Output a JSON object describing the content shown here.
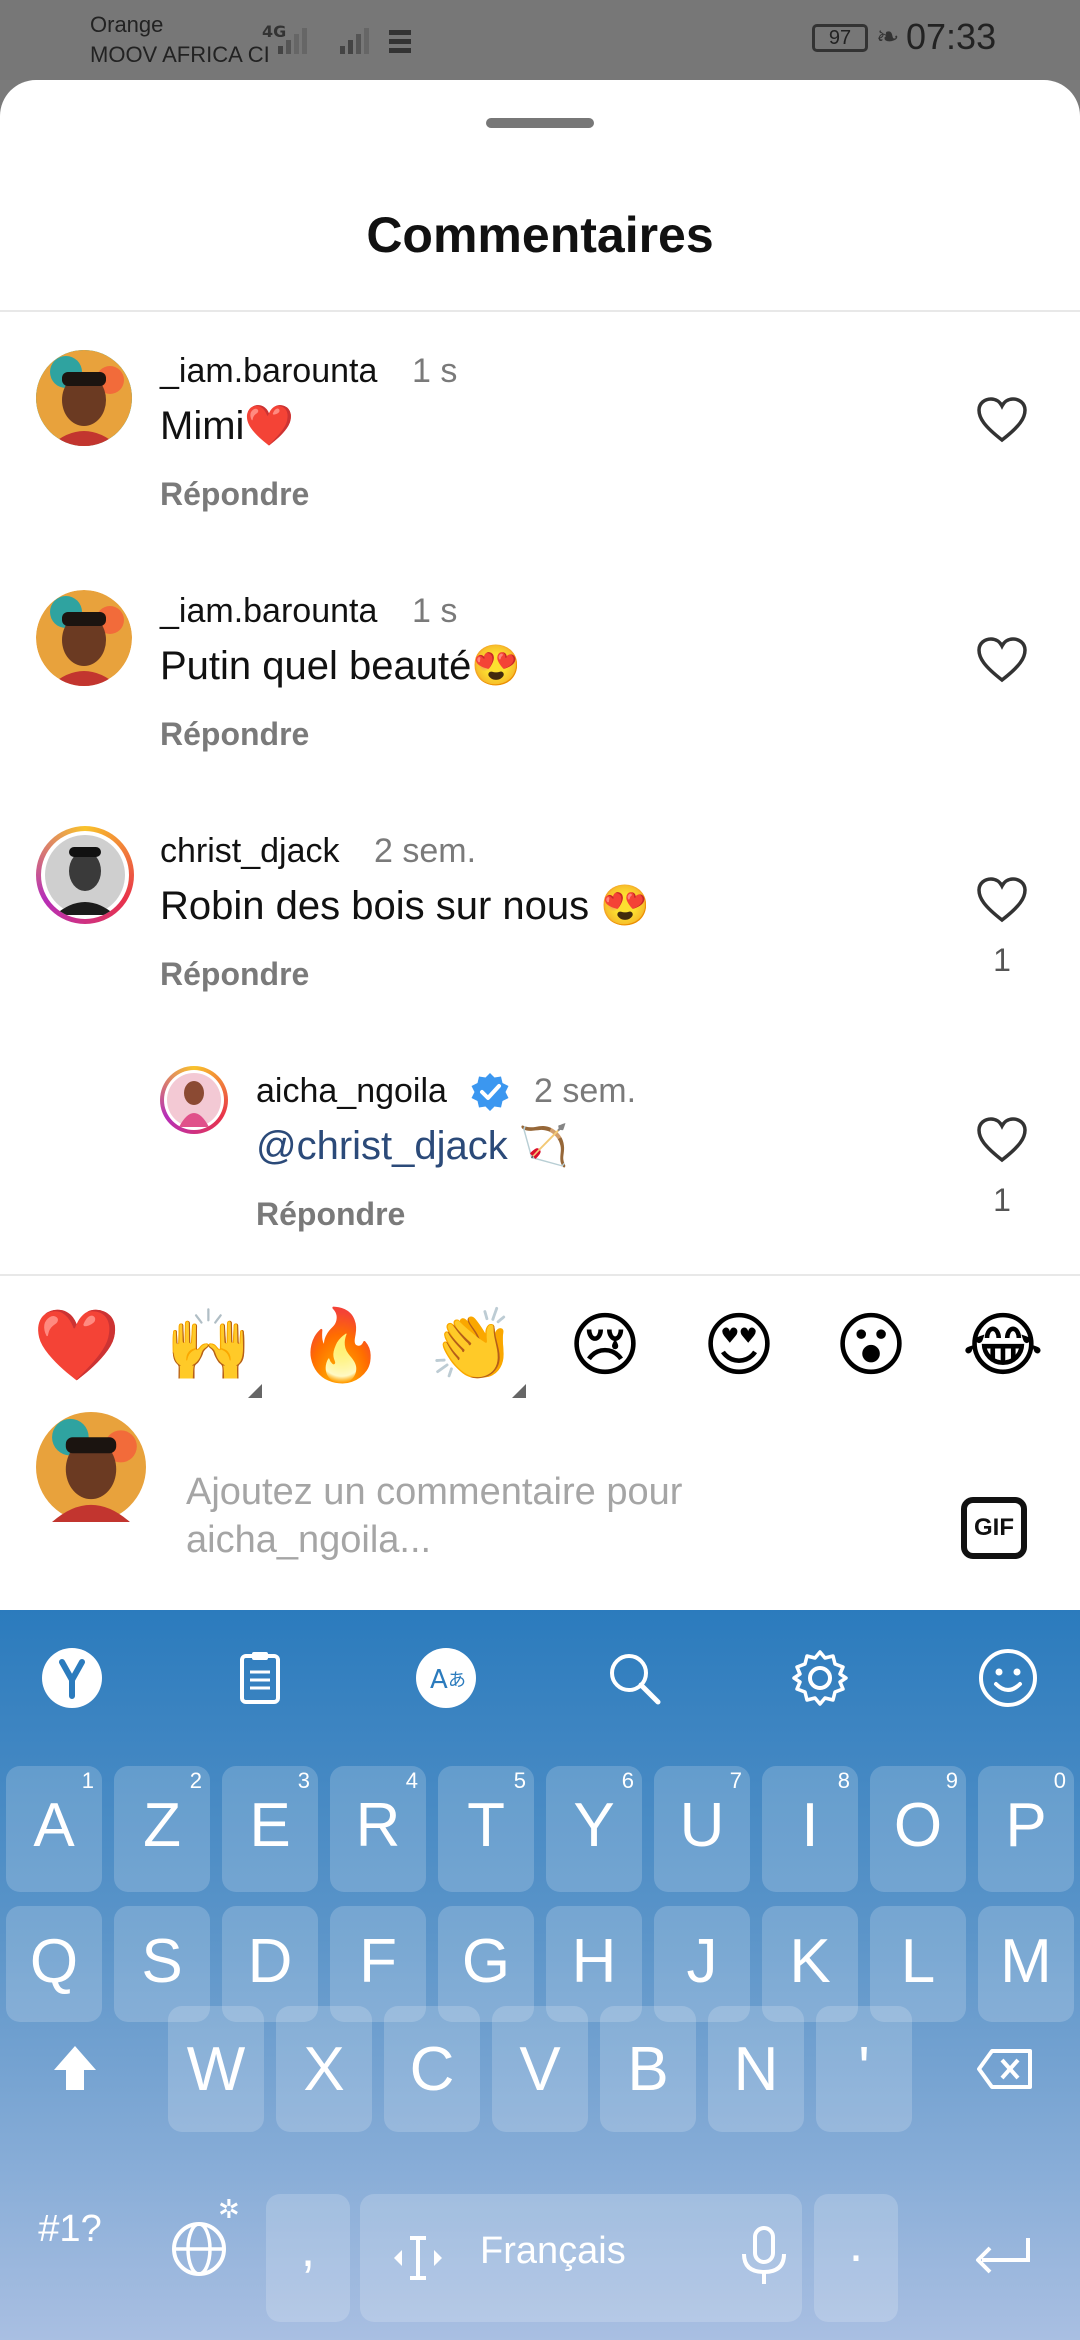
{
  "status_bar": {
    "carrier_line1": "Orange",
    "carrier_line2": "MOOV AFRICA CI",
    "network": "4G",
    "battery": "97",
    "time": "07:33"
  },
  "sheet": {
    "title": "Commentaires"
  },
  "comments": [
    {
      "username": "_iam.barounta",
      "time": "1 s",
      "text": "Mimi❤️",
      "reply": "Répondre",
      "likes": ""
    },
    {
      "username": "_iam.barounta",
      "time": "1 s",
      "text": "Putin quel beauté😍",
      "reply": "Répondre",
      "likes": ""
    },
    {
      "username": "christ_djack",
      "time": "2 sem.",
      "text": "Robin des bois sur nous 😍",
      "reply": "Répondre",
      "likes": "1"
    },
    {
      "username": "aicha_ngoila",
      "time": "2 sem.",
      "mention": "@christ_djack",
      "text": " 🏹",
      "reply": "Répondre",
      "likes": "1",
      "verified": true
    }
  ],
  "quick_emojis": [
    "❤️",
    "🙌",
    "🔥",
    "👏",
    "😢",
    "😍",
    "😮",
    "😂"
  ],
  "composer": {
    "placeholder": "Ajoutez un commentaire pour aicha_ngoila...",
    "gif_label": "GIF"
  },
  "keyboard": {
    "toolbar_icons": [
      "yandex-logo-icon",
      "clipboard-icon",
      "translate-icon",
      "search-icon",
      "settings-gear-icon",
      "emoji-smiley-icon"
    ],
    "row1": [
      {
        "k": "A",
        "n": "1"
      },
      {
        "k": "Z",
        "n": "2"
      },
      {
        "k": "E",
        "n": "3"
      },
      {
        "k": "R",
        "n": "4"
      },
      {
        "k": "T",
        "n": "5"
      },
      {
        "k": "Y",
        "n": "6"
      },
      {
        "k": "U",
        "n": "7"
      },
      {
        "k": "I",
        "n": "8"
      },
      {
        "k": "O",
        "n": "9"
      },
      {
        "k": "P",
        "n": "0"
      }
    ],
    "row2": [
      "Q",
      "S",
      "D",
      "F",
      "G",
      "H",
      "J",
      "K",
      "L",
      "M"
    ],
    "row3": [
      "W",
      "X",
      "C",
      "V",
      "B",
      "N",
      "'"
    ],
    "symbols_label": "#1?",
    "comma": ",",
    "space_label": "Français",
    "period": ".",
    "colors": {
      "top": "#2b7bbd",
      "bottom": "#a9bfe2"
    }
  }
}
